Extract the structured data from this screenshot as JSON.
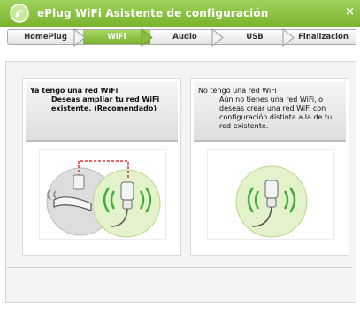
{
  "window": {
    "title": "ePlug WiFi Asistente de configuración",
    "close_glyph": "×"
  },
  "tabs": [
    {
      "label": "HomePlug",
      "active": false
    },
    {
      "label": "WiFi",
      "active": true
    },
    {
      "label": "Audio",
      "active": false
    },
    {
      "label": "USB",
      "active": false
    },
    {
      "label": "Finalización",
      "active": false
    }
  ],
  "options": [
    {
      "title": "Ya tengo una red WiFi",
      "description": "Deseas ampliar tu red WiFi existente. (Recomendado)",
      "illustration": "router-and-plug-icon"
    },
    {
      "title": "No tengo una red WiFi",
      "description": "Aún no tienes una red WiFi, o deseas crear una red WiFi con configuración distinta a la de tu red existente.",
      "illustration": "wifi-plug-icon"
    }
  ],
  "colors": {
    "accent": "#7ab32e",
    "accent_light": "#a7d864",
    "link_red": "#e53030"
  }
}
